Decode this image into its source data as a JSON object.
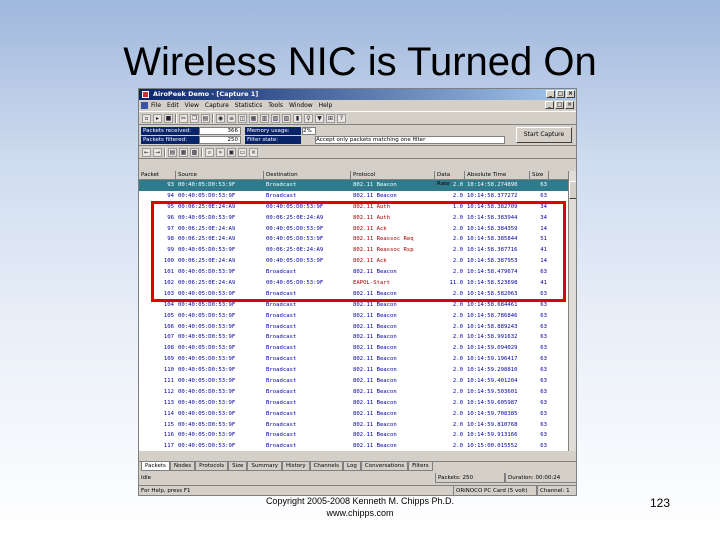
{
  "slide": {
    "title": "Wireless NIC is Turned On",
    "copyright": "Copyright 2005-2008 Kenneth M. Chipps Ph.D.",
    "website": "www.chipps.com",
    "page_number": "123",
    "highlight_color": "#e00000"
  },
  "window": {
    "title": "AiroPeek Demo - [Capture 1]",
    "buttons": [
      "_",
      "□",
      "×"
    ],
    "menu": [
      "File",
      "Edit",
      "View",
      "Capture",
      "Statistics",
      "Tools",
      "Window",
      "Help"
    ]
  },
  "stats": {
    "packets_received_label": "Packets received:",
    "packets_received_value": "366",
    "packets_filtered_label": "Packets filtered:",
    "packets_filtered_value": "250",
    "memory_usage_label": "Memory usage:",
    "memory_usage_value": "2%",
    "filter_state_label": "Filter state:",
    "filter_state_value": "Accept only packets matching one filter",
    "start_capture_label": "Start Capture"
  },
  "columns": [
    "Packet",
    "Source",
    "Destination",
    "Protocol",
    "Data Rate",
    "Absolute Time",
    "Size"
  ],
  "rows": [
    {
      "packet": "93",
      "source": "00:40:05:D0:53:9F",
      "dest": "Broadcast",
      "proto": "802.11 Beacon",
      "rate": "2.0",
      "time": "10:14:58.274890",
      "size": "63",
      "selected": true
    },
    {
      "packet": "94",
      "source": "00:40:05:D0:53:9F",
      "dest": "Broadcast",
      "proto": "802.11 Beacon",
      "rate": "2.0",
      "time": "10:14:58.377272",
      "size": "63"
    },
    {
      "packet": "95",
      "source": "00:06:25:0E:24:A9",
      "dest": "00:40:05:D0:53:9F",
      "proto": "802.11 Auth",
      "rate": "1.0",
      "time": "10:14:58.382709",
      "size": "34",
      "color": "#a00000"
    },
    {
      "packet": "96",
      "source": "00:40:05:D0:53:9F",
      "dest": "00:06:25:0E:24:A9",
      "proto": "802.11 Auth",
      "rate": "2.0",
      "time": "10:14:58.383944",
      "size": "34",
      "color": "#a00000"
    },
    {
      "packet": "97",
      "source": "00:06:25:0E:24:A9",
      "dest": "00:40:05:D0:53:9F",
      "proto": "802.11 Ack",
      "rate": "2.0",
      "time": "10:14:58.384359",
      "size": "14",
      "color": "#a00000"
    },
    {
      "packet": "98",
      "source": "00:06:25:0E:24:A9",
      "dest": "00:40:05:D0:53:9F",
      "proto": "802.11 Reassoc Req",
      "rate": "2.0",
      "time": "10:14:58.385844",
      "size": "51",
      "color": "#a00000"
    },
    {
      "packet": "99",
      "source": "00:40:05:D0:53:9F",
      "dest": "00:06:25:0E:24:A9",
      "proto": "802.11 Reassoc Rsp",
      "rate": "2.0",
      "time": "10:14:58.387716",
      "size": "41",
      "color": "#a00000"
    },
    {
      "packet": "100",
      "source": "00:06:25:0E:24:A9",
      "dest": "00:40:05:D0:53:9F",
      "proto": "802.11 Ack",
      "rate": "2.0",
      "time": "10:14:58.387953",
      "size": "14",
      "color": "#a00000"
    },
    {
      "packet": "101",
      "source": "00:40:05:D0:53:9F",
      "dest": "Broadcast",
      "proto": "802.11 Beacon",
      "rate": "2.0",
      "time": "10:14:58.479674",
      "size": "63"
    },
    {
      "packet": "102",
      "source": "00:06:25:0E:24:A9",
      "dest": "00:40:05:D0:53:9F",
      "proto": "EAPOL-Start",
      "rate": "11.0",
      "time": "10:14:58.523698",
      "size": "41",
      "color": "#a00000"
    },
    {
      "packet": "103",
      "source": "00:40:05:D0:53:9F",
      "dest": "Broadcast",
      "proto": "802.11 Beacon",
      "rate": "2.0",
      "time": "10:14:58.582063",
      "size": "63"
    },
    {
      "packet": "104",
      "source": "00:40:05:D0:53:9F",
      "dest": "Broadcast",
      "proto": "802.11 Beacon",
      "rate": "2.0",
      "time": "10:14:58.684461",
      "size": "63"
    },
    {
      "packet": "105",
      "source": "00:40:05:D0:53:9F",
      "dest": "Broadcast",
      "proto": "802.11 Beacon",
      "rate": "2.0",
      "time": "10:14:58.786846",
      "size": "63"
    },
    {
      "packet": "106",
      "source": "00:40:05:D0:53:9F",
      "dest": "Broadcast",
      "proto": "802.11 Beacon",
      "rate": "2.0",
      "time": "10:14:58.889243",
      "size": "63"
    },
    {
      "packet": "107",
      "source": "00:40:05:D0:53:9F",
      "dest": "Broadcast",
      "proto": "802.11 Beacon",
      "rate": "2.0",
      "time": "10:14:58.991632",
      "size": "63"
    },
    {
      "packet": "108",
      "source": "00:40:05:D0:53:9F",
      "dest": "Broadcast",
      "proto": "802.11 Beacon",
      "rate": "2.0",
      "time": "10:14:59.094029",
      "size": "63"
    },
    {
      "packet": "109",
      "source": "00:40:05:D0:53:9F",
      "dest": "Broadcast",
      "proto": "802.11 Beacon",
      "rate": "2.0",
      "time": "10:14:59.196417",
      "size": "63"
    },
    {
      "packet": "110",
      "source": "00:40:05:D0:53:9F",
      "dest": "Broadcast",
      "proto": "802.11 Beacon",
      "rate": "2.0",
      "time": "10:14:59.298810",
      "size": "63"
    },
    {
      "packet": "111",
      "source": "00:40:05:D0:53:9F",
      "dest": "Broadcast",
      "proto": "802.11 Beacon",
      "rate": "2.0",
      "time": "10:14:59.401204",
      "size": "63"
    },
    {
      "packet": "112",
      "source": "00:40:05:D0:53:9F",
      "dest": "Broadcast",
      "proto": "802.11 Beacon",
      "rate": "2.0",
      "time": "10:14:59.503601",
      "size": "63"
    },
    {
      "packet": "113",
      "source": "00:40:05:D0:53:9F",
      "dest": "Broadcast",
      "proto": "802.11 Beacon",
      "rate": "2.0",
      "time": "10:14:59.605987",
      "size": "63"
    },
    {
      "packet": "114",
      "source": "00:40:05:D0:53:9F",
      "dest": "Broadcast",
      "proto": "802.11 Beacon",
      "rate": "2.0",
      "time": "10:14:59.708385",
      "size": "63"
    },
    {
      "packet": "115",
      "source": "00:40:05:D0:53:9F",
      "dest": "Broadcast",
      "proto": "802.11 Beacon",
      "rate": "2.0",
      "time": "10:14:59.810768",
      "size": "63"
    },
    {
      "packet": "116",
      "source": "00:40:05:D0:53:9F",
      "dest": "Broadcast",
      "proto": "802.11 Beacon",
      "rate": "2.0",
      "time": "10:14:59.913166",
      "size": "63"
    },
    {
      "packet": "117",
      "source": "00:40:05:D0:53:9F",
      "dest": "Broadcast",
      "proto": "802.11 Beacon",
      "rate": "2.0",
      "time": "10:15:00.015552",
      "size": "63"
    }
  ],
  "tabs": [
    "Packets",
    "Nodes",
    "Protocols",
    "Size",
    "Summary",
    "History",
    "Channels",
    "Log",
    "Conversations",
    "Filters"
  ],
  "status": {
    "state": "Idle",
    "packets_label": "Packets: 250",
    "duration_label": "Duration: 00:00:24",
    "help_text": "For Help, press F1",
    "adapter": "ORiNOCO PC Card (5 volt)",
    "channel": "Channel: 1"
  }
}
